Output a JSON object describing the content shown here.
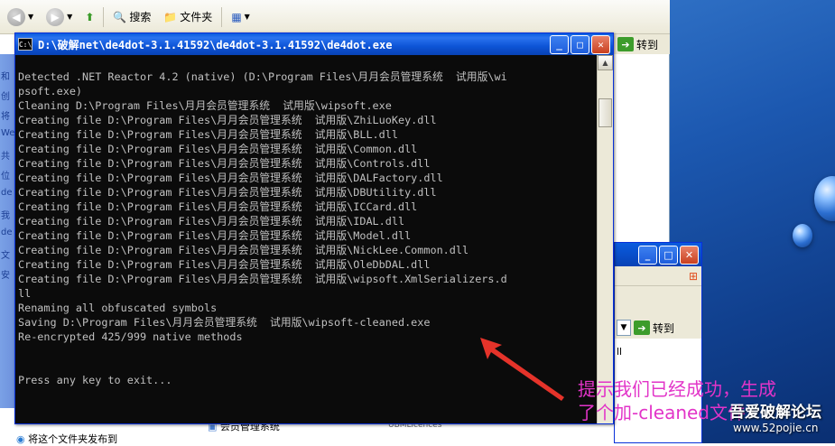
{
  "explorer": {
    "toolbar": {
      "search_label": "搜索",
      "folders_label": "文件夹"
    },
    "go_label": "转到",
    "sidebar_fragments": [
      "和",
      "创",
      "将",
      "Wel",
      "共",
      "位",
      "de",
      "我",
      "de",
      "文",
      "安"
    ],
    "bottom_item_1": "会员管理系统",
    "bottom_item_2": "UBMLicences",
    "bottom_task": "将这个文件夹发布到"
  },
  "window2": {
    "go_label": "转到",
    "fragment": "ll"
  },
  "console": {
    "title": "D:\\破解net\\de4dot-3.1.41592\\de4dot-3.1.41592\\de4dot.exe",
    "lines": [
      "",
      "Detected .NET Reactor 4.2 (native) (D:\\Program Files\\月月会员管理系统  试用版\\wi",
      "psoft.exe)",
      "Cleaning D:\\Program Files\\月月会员管理系统  试用版\\wipsoft.exe",
      "Creating file D:\\Program Files\\月月会员管理系统  试用版\\ZhiLuoKey.dll",
      "Creating file D:\\Program Files\\月月会员管理系统  试用版\\BLL.dll",
      "Creating file D:\\Program Files\\月月会员管理系统  试用版\\Common.dll",
      "Creating file D:\\Program Files\\月月会员管理系统  试用版\\Controls.dll",
      "Creating file D:\\Program Files\\月月会员管理系统  试用版\\DALFactory.dll",
      "Creating file D:\\Program Files\\月月会员管理系统  试用版\\DBUtility.dll",
      "Creating file D:\\Program Files\\月月会员管理系统  试用版\\ICCard.dll",
      "Creating file D:\\Program Files\\月月会员管理系统  试用版\\IDAL.dll",
      "Creating file D:\\Program Files\\月月会员管理系统  试用版\\Model.dll",
      "Creating file D:\\Program Files\\月月会员管理系统  试用版\\NickLee.Common.dll",
      "Creating file D:\\Program Files\\月月会员管理系统  试用版\\OleDbDAL.dll",
      "Creating file D:\\Program Files\\月月会员管理系统  试用版\\wipsoft.XmlSerializers.d",
      "ll",
      "Renaming all obfuscated symbols",
      "Saving D:\\Program Files\\月月会员管理系统  试用版\\wipsoft-cleaned.exe",
      "Re-encrypted 425/999 native methods",
      "",
      "",
      "Press any key to exit..."
    ]
  },
  "annotation": {
    "line1": "提示我们已经成功，生成",
    "line2": "了个加-cleaned文件",
    "color": "#e234c8"
  },
  "watermark": {
    "name": "吾爱破解论坛",
    "url": "www.52pojie.cn"
  }
}
